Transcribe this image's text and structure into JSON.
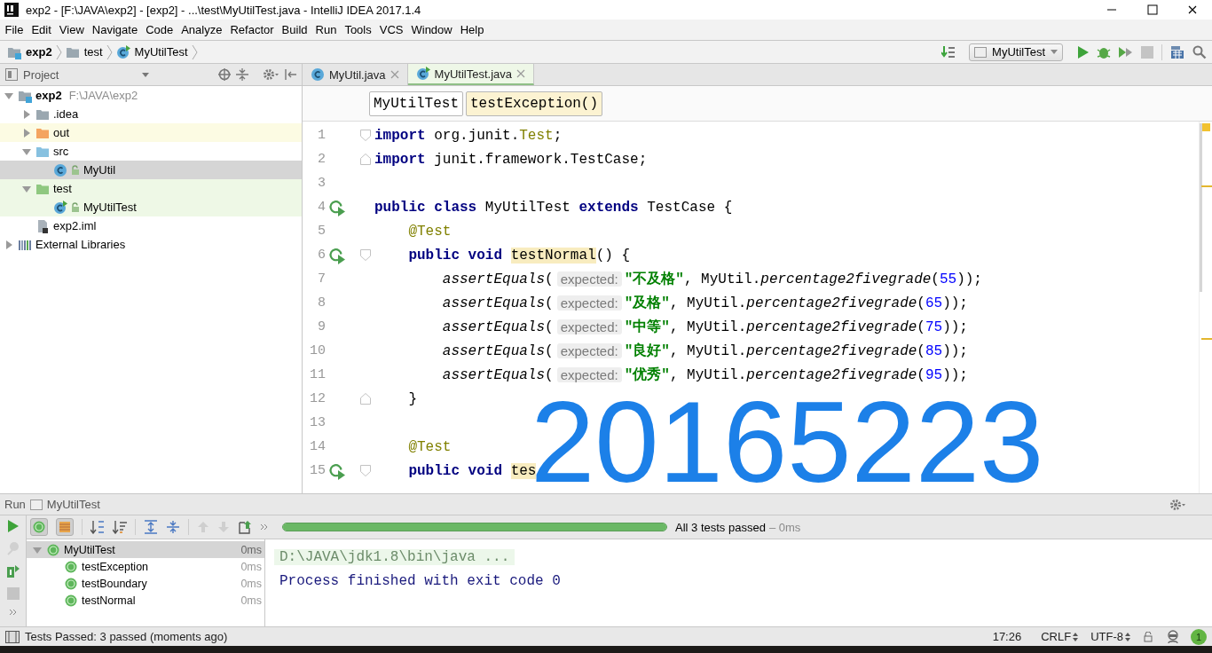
{
  "window": {
    "title": "exp2 - [F:\\JAVA\\exp2] - [exp2] - ...\\test\\MyUtilTest.java - IntelliJ IDEA 2017.1.4"
  },
  "menu": [
    "File",
    "Edit",
    "View",
    "Navigate",
    "Code",
    "Analyze",
    "Refactor",
    "Build",
    "Run",
    "Tools",
    "VCS",
    "Window",
    "Help"
  ],
  "navigation_bar": {
    "breadcrumbs": [
      {
        "label": "exp2",
        "kind": "module"
      },
      {
        "label": "test",
        "kind": "folder"
      },
      {
        "label": "MyUtilTest",
        "kind": "test-class"
      }
    ],
    "run_configuration": "MyUtilTest"
  },
  "project_panel": {
    "title": "Project",
    "tree": [
      {
        "label": "exp2",
        "path": "F:\\JAVA\\exp2",
        "kind": "module",
        "expanded": true,
        "selected": false,
        "children": [
          {
            "label": ".idea",
            "kind": "folder",
            "color": "#9aa7b0",
            "expanded": false,
            "selected": false
          },
          {
            "label": "out",
            "kind": "folder",
            "color": "#f4a460",
            "expanded": false,
            "selected": false,
            "excluded": true
          },
          {
            "label": "src",
            "kind": "folder",
            "color": "#87c1e0",
            "expanded": true,
            "selected": false,
            "children": [
              {
                "label": "MyUtil",
                "kind": "class",
                "selected": true
              }
            ]
          },
          {
            "label": "test",
            "kind": "folder",
            "color": "#8fc880",
            "expanded": true,
            "selected": false,
            "test_scope": true,
            "children": [
              {
                "label": "MyUtilTest",
                "kind": "test-class",
                "selected": false,
                "test_scope": true
              }
            ]
          },
          {
            "label": "exp2.iml",
            "kind": "file",
            "selected": false
          }
        ]
      },
      {
        "label": "External Libraries",
        "kind": "library",
        "expanded": false,
        "selected": false
      }
    ]
  },
  "editor": {
    "tabs": [
      {
        "label": "MyUtil.java",
        "kind": "class",
        "selected": false
      },
      {
        "label": "MyUtilTest.java",
        "kind": "test-class",
        "selected": true
      }
    ],
    "breadcrumbs": [
      {
        "label": "MyUtilTest",
        "selected": false
      },
      {
        "label": "testException()",
        "selected": true
      }
    ],
    "lines": [
      {
        "number": "1",
        "fold_start": true,
        "tokens": [
          {
            "kind": "keyword",
            "text": "import "
          },
          {
            "kind": "plain",
            "text": "org.junit."
          },
          {
            "kind": "type",
            "text": "Test"
          },
          {
            "kind": "plain",
            "text": ";"
          }
        ]
      },
      {
        "number": "2",
        "fold_end": true,
        "tokens": [
          {
            "kind": "keyword",
            "text": "import "
          },
          {
            "kind": "plain",
            "text": "junit.framework.TestCase;"
          }
        ]
      },
      {
        "number": "3"
      },
      {
        "number": "4",
        "run": true,
        "tokens": [
          {
            "kind": "keyword",
            "text": "public class "
          },
          {
            "kind": "plain",
            "text": "MyUtilTest "
          },
          {
            "kind": "keyword",
            "text": "extends "
          },
          {
            "kind": "plain",
            "text": "TestCase {"
          }
        ]
      },
      {
        "number": "5",
        "tokens": [
          {
            "kind": "annotation",
            "text": "    @Test"
          }
        ]
      },
      {
        "number": "6",
        "run": true,
        "fold_start": true,
        "tokens": [
          {
            "kind": "keyword",
            "text": "    public void "
          },
          {
            "kind": "method",
            "text": "testNormal"
          },
          {
            "kind": "plain",
            "text": "() {"
          }
        ]
      },
      {
        "number": "7",
        "tokens": [
          {
            "kind": "call",
            "text": "        assertEquals"
          },
          {
            "kind": "plain",
            "text": "("
          },
          {
            "kind": "hint",
            "text": "expected:"
          },
          {
            "kind": "string",
            "text": "\"不及格\""
          },
          {
            "kind": "plain",
            "text": ", MyUtil."
          },
          {
            "kind": "call",
            "text": "percentage2fivegrade"
          },
          {
            "kind": "plain",
            "text": "("
          },
          {
            "kind": "number",
            "text": "55"
          },
          {
            "kind": "plain",
            "text": "));"
          }
        ]
      },
      {
        "number": "8",
        "tokens": [
          {
            "kind": "call",
            "text": "        assertEquals"
          },
          {
            "kind": "plain",
            "text": "("
          },
          {
            "kind": "hint",
            "text": "expected:"
          },
          {
            "kind": "string",
            "text": "\"及格\""
          },
          {
            "kind": "plain",
            "text": ", MyUtil."
          },
          {
            "kind": "call",
            "text": "percentage2fivegrade"
          },
          {
            "kind": "plain",
            "text": "("
          },
          {
            "kind": "number",
            "text": "65"
          },
          {
            "kind": "plain",
            "text": "));"
          }
        ]
      },
      {
        "number": "9",
        "tokens": [
          {
            "kind": "call",
            "text": "        assertEquals"
          },
          {
            "kind": "plain",
            "text": "("
          },
          {
            "kind": "hint",
            "text": "expected:"
          },
          {
            "kind": "string",
            "text": "\"中等\""
          },
          {
            "kind": "plain",
            "text": ", MyUtil."
          },
          {
            "kind": "call",
            "text": "percentage2fivegrade"
          },
          {
            "kind": "plain",
            "text": "("
          },
          {
            "kind": "number",
            "text": "75"
          },
          {
            "kind": "plain",
            "text": "));"
          }
        ]
      },
      {
        "number": "10",
        "tokens": [
          {
            "kind": "call",
            "text": "        assertEquals"
          },
          {
            "kind": "plain",
            "text": "("
          },
          {
            "kind": "hint",
            "text": "expected:"
          },
          {
            "kind": "string",
            "text": "\"良好\""
          },
          {
            "kind": "plain",
            "text": ", MyUtil."
          },
          {
            "kind": "call",
            "text": "percentage2fivegrade"
          },
          {
            "kind": "plain",
            "text": "("
          },
          {
            "kind": "number",
            "text": "85"
          },
          {
            "kind": "plain",
            "text": "));"
          }
        ]
      },
      {
        "number": "11",
        "tokens": [
          {
            "kind": "call",
            "text": "        assertEquals"
          },
          {
            "kind": "plain",
            "text": "("
          },
          {
            "kind": "hint",
            "text": "expected:"
          },
          {
            "kind": "string",
            "text": "\"优秀\""
          },
          {
            "kind": "plain",
            "text": ", MyUtil."
          },
          {
            "kind": "call",
            "text": "percentage2fivegrade"
          },
          {
            "kind": "plain",
            "text": "("
          },
          {
            "kind": "number",
            "text": "95"
          },
          {
            "kind": "plain",
            "text": "));"
          }
        ]
      },
      {
        "number": "12",
        "fold_end": true,
        "tokens": [
          {
            "kind": "plain",
            "text": "    }"
          }
        ]
      },
      {
        "number": "13"
      },
      {
        "number": "14",
        "tokens": [
          {
            "kind": "annotation",
            "text": "    @Test"
          }
        ]
      },
      {
        "number": "15",
        "run": true,
        "fold_start": true,
        "tokens": [
          {
            "kind": "keyword",
            "text": "    public void "
          },
          {
            "kind": "method",
            "text": "tes"
          }
        ]
      }
    ]
  },
  "overlay_text": "20165223",
  "run_panel": {
    "title": "Run",
    "configuration": "MyUtilTest",
    "toggles": [
      {
        "kind": "show-passed",
        "on": true
      },
      {
        "kind": "show-ignored",
        "on": true
      }
    ],
    "progress": {
      "level": 1
    },
    "summary": "All 3 tests passed",
    "duration": "– 0ms",
    "tests": [
      {
        "name": "MyUtilTest",
        "time": "0ms",
        "passed": true,
        "selected": true,
        "expanded": true,
        "children": [
          {
            "name": "testException",
            "time": "0ms",
            "passed": true,
            "selected": false
          },
          {
            "name": "testBoundary",
            "time": "0ms",
            "passed": true,
            "selected": false
          },
          {
            "name": "testNormal",
            "time": "0ms",
            "passed": true,
            "selected": false
          }
        ]
      }
    ],
    "console": [
      {
        "kind": "command",
        "text": "D:\\JAVA\\jdk1.8\\bin\\java ..."
      },
      {
        "kind": "output",
        "text": "Process finished with exit code 0"
      }
    ]
  },
  "status_bar": {
    "message": "Tests Passed: 3 passed (moments ago)",
    "position": "17:26",
    "line_separator": "CRLF",
    "encoding": "UTF-8",
    "notifications": "1"
  }
}
